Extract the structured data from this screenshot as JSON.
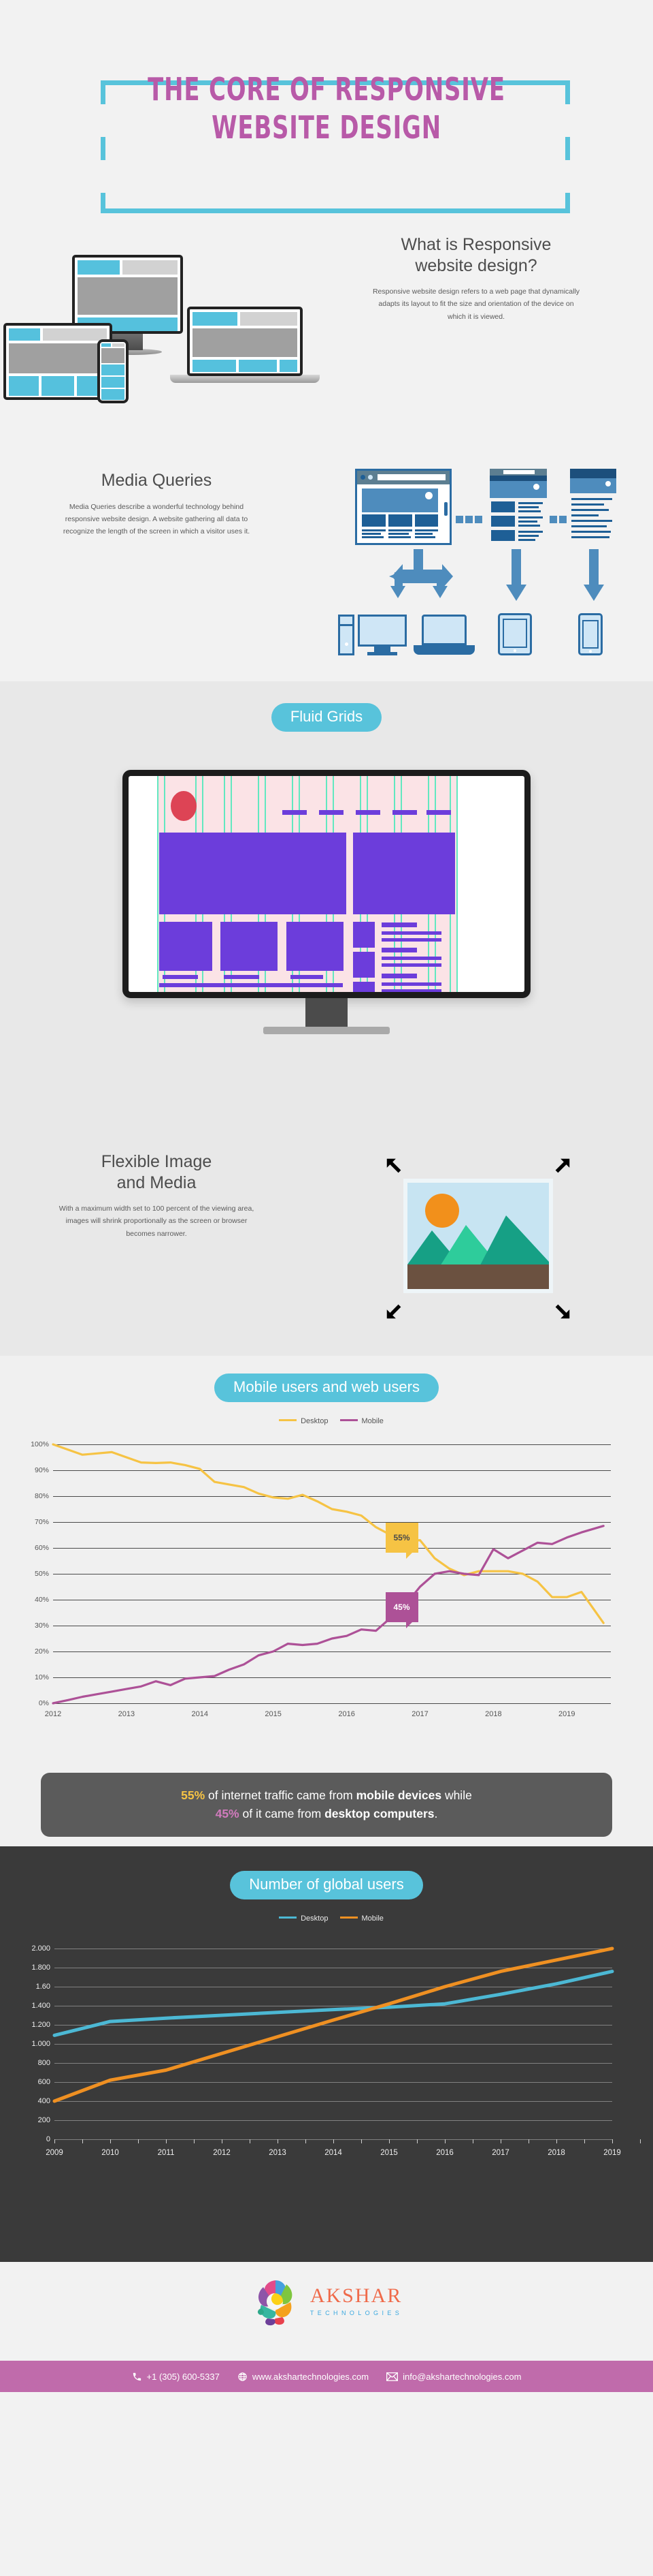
{
  "title": {
    "line1": "THE CORE OF RESPONSIVE",
    "line2": "WEBSITE DESIGN"
  },
  "colors": {
    "accent_cyan": "#58c3db",
    "accent_pink": "#b85aa8",
    "page_bg": "#f2f2f2",
    "dark_section": "#3a3a3a",
    "banner_bg": "#5b5b5b",
    "desktop_yellow": "#f6c344",
    "mobile_purple": "#ad5197",
    "desktop_cyan": "#4cb8d4",
    "mobile_orange": "#ef9022",
    "footer_bar": "#c06bab",
    "logo_orange": "#ef6a4a",
    "logo_blue": "#3aa8e0"
  },
  "what_is": {
    "heading_line1": "What is Responsive",
    "heading_line2": "website design?",
    "body": "Responsive website design refers to a web page that dynamically adapts its layout to fit the size and orientation of the device on which it is viewed."
  },
  "media_queries": {
    "heading": "Media Queries",
    "body": "Media Queries describe a wonderful technology behind responsive website design. A website gathering all data to recognize the length of the screen in which a visitor uses it."
  },
  "fluid_grids": {
    "pill_label": "Fluid Grids"
  },
  "flexible_image": {
    "heading_line1": "Flexible Image",
    "heading_line2": "and Media",
    "body": "With a maximum width set to 100 percent of the viewing area, images will shrink proportionally as the screen or browser becomes narrower."
  },
  "mobile_users": {
    "pill_label": "Mobile users and web users",
    "banner": {
      "v55": "55%",
      "t1": " of internet traffic came from ",
      "b1": "mobile devices",
      "t2": " while ",
      "v45": "45%",
      "t3": " of it came from ",
      "b2": "desktop computers",
      "t4": "."
    }
  },
  "global_users": {
    "pill_label": "Number of global users"
  },
  "footer": {
    "logo_name": "AKSHAR",
    "logo_sub": "TECHNOLOGIES",
    "phone": "+1 (305) 600-5337",
    "website": "www.akshartechnologies.com",
    "email": "info@akshartechnologies.com"
  },
  "chart_data": [
    {
      "type": "line",
      "title": "Mobile users and web users",
      "xlabel": "",
      "ylabel": "",
      "ylim": [
        0,
        100
      ],
      "xlim": [
        2012,
        2019.6
      ],
      "grid": true,
      "legend_position": "top-center",
      "ytick_labels": [
        "0%",
        "10%",
        "20%",
        "30%",
        "40%",
        "50%",
        "60%",
        "70%",
        "80%",
        "90%",
        "100%"
      ],
      "ytick_values": [
        0,
        10,
        20,
        30,
        40,
        50,
        60,
        70,
        80,
        90,
        100
      ],
      "xtick_labels": [
        "2012",
        "2013",
        "2014",
        "2015",
        "2016",
        "2017",
        "2018",
        "2019"
      ],
      "xtick_values": [
        2012,
        2013,
        2014,
        2015,
        2016,
        2017,
        2018,
        2019
      ],
      "annotations": [
        {
          "label": "55%",
          "color": "#f6c344",
          "x": 2016.75,
          "y": 64
        },
        {
          "label": "45%",
          "color": "#ad5197",
          "x": 2016.75,
          "y": 37
        }
      ],
      "series": [
        {
          "name": "Desktop",
          "color": "#f6c344",
          "x": [
            2012.0,
            2012.2,
            2012.4,
            2012.6,
            2012.8,
            2013.0,
            2013.2,
            2013.4,
            2013.6,
            2013.8,
            2014.0,
            2014.2,
            2014.4,
            2014.6,
            2014.8,
            2015.0,
            2015.2,
            2015.4,
            2015.6,
            2015.8,
            2016.0,
            2016.2,
            2016.4,
            2016.6,
            2016.8,
            2017.0,
            2017.2,
            2017.4,
            2017.6,
            2017.8,
            2018.0,
            2018.2,
            2018.4,
            2018.6,
            2018.8,
            2019.0,
            2019.2,
            2019.5
          ],
          "values": [
            100,
            98,
            96,
            96.5,
            97,
            95,
            93,
            92.8,
            93,
            92,
            90.5,
            85.5,
            84.5,
            83.5,
            81,
            79.5,
            79,
            80.5,
            78,
            75,
            74,
            72.5,
            68,
            65,
            62.5,
            63,
            56,
            52,
            49.5,
            51,
            51,
            51,
            50,
            47,
            41,
            41,
            43,
            31
          ]
        },
        {
          "name": "Mobile",
          "color": "#ad5197",
          "x": [
            2012.0,
            2012.2,
            2012.4,
            2012.6,
            2012.8,
            2013.0,
            2013.2,
            2013.4,
            2013.6,
            2013.8,
            2014.0,
            2014.2,
            2014.4,
            2014.6,
            2014.8,
            2015.0,
            2015.2,
            2015.4,
            2015.6,
            2015.8,
            2016.0,
            2016.2,
            2016.4,
            2016.6,
            2016.8,
            2017.0,
            2017.2,
            2017.4,
            2017.6,
            2017.8,
            2018.0,
            2018.2,
            2018.4,
            2018.6,
            2018.8,
            2019.0,
            2019.2,
            2019.5
          ],
          "values": [
            0,
            1.2,
            2.5,
            3.5,
            4.5,
            5.5,
            6.5,
            8.5,
            7,
            9.5,
            10,
            10.5,
            13,
            15,
            18.5,
            20,
            23,
            22.5,
            23,
            25,
            26,
            28.5,
            28,
            33,
            38,
            45,
            50,
            51,
            50,
            49.5,
            59.5,
            56,
            59,
            62,
            61.5,
            64,
            66,
            68.5
          ]
        }
      ]
    },
    {
      "type": "line",
      "title": "Number of global users",
      "xlabel": "",
      "ylabel": "",
      "ylim": [
        0,
        2000
      ],
      "xlim": [
        2009,
        2019
      ],
      "grid": true,
      "legend_position": "top-center",
      "ytick_labels": [
        "0",
        "200",
        "400",
        "600",
        "800",
        "1.000",
        "1.200",
        "1.400",
        "1.60",
        "1.800",
        "2.000"
      ],
      "ytick_values": [
        0,
        200,
        400,
        600,
        800,
        1000,
        1200,
        1400,
        1600,
        1800,
        2000
      ],
      "xtick_labels": [
        "2009",
        "2010",
        "2011",
        "2012",
        "2013",
        "2014",
        "2015",
        "2016",
        "2017",
        "2018",
        "2019"
      ],
      "xtick_values": [
        2009,
        2010,
        2011,
        2012,
        2013,
        2014,
        2015,
        2016,
        2017,
        2018,
        2019
      ],
      "series": [
        {
          "name": "Desktop",
          "color": "#4cb8d4",
          "x": [
            2009,
            2010,
            2011,
            2012,
            2013,
            2014,
            2015,
            2016,
            2017,
            2018,
            2019
          ],
          "values": [
            1090,
            1235,
            1270,
            1300,
            1330,
            1360,
            1385,
            1420,
            1520,
            1630,
            1760
          ]
        },
        {
          "name": "Mobile",
          "color": "#ef9022",
          "x": [
            2009,
            2010,
            2011,
            2012,
            2013,
            2014,
            2015,
            2016,
            2017,
            2018,
            2019
          ],
          "values": [
            400,
            620,
            725,
            900,
            1075,
            1250,
            1420,
            1600,
            1760,
            1880,
            2000
          ]
        }
      ]
    }
  ]
}
